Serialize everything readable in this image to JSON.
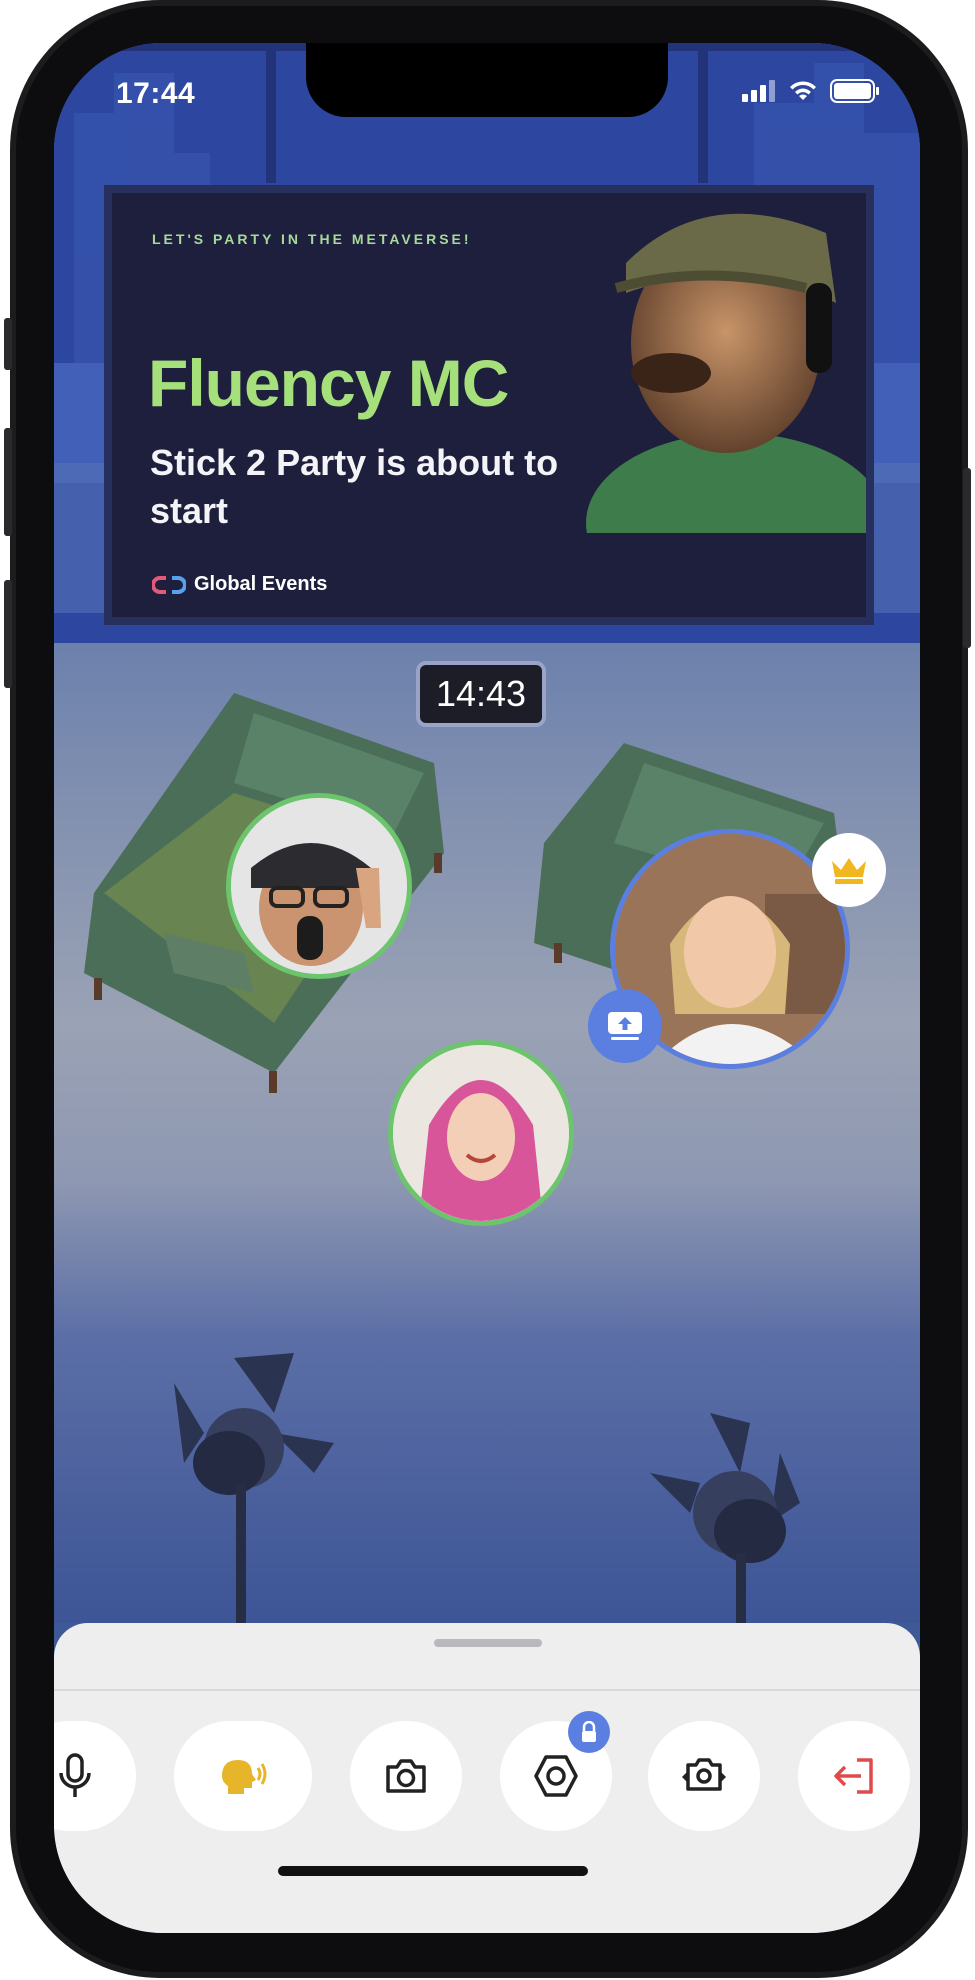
{
  "status_bar": {
    "time": "17:44"
  },
  "banner": {
    "tagline": "LET'S PARTY IN THE METAVERSE!",
    "title": "Fluency MC",
    "subtitle": "Stick 2 Party is about to start",
    "brand": "Global Events"
  },
  "stage": {
    "clock": "14:43"
  },
  "participants": [
    {
      "name": "host-man-headset",
      "ring_color": "#6cc46c"
    },
    {
      "name": "girl-blonde",
      "ring_color": "#5b7fe0",
      "is_host": true,
      "is_sharing": true
    },
    {
      "name": "woman-pink-hair",
      "ring_color": "#6cc46c"
    }
  ],
  "toolbar": {
    "items": [
      {
        "icon": "microphone-icon"
      },
      {
        "icon": "speaking-head-icon",
        "color": "#e7b52a"
      },
      {
        "icon": "camera-icon"
      },
      {
        "icon": "hexagon-settings-icon",
        "locked": true
      },
      {
        "icon": "flip-camera-icon"
      },
      {
        "icon": "leave-icon",
        "color": "#e04a4a"
      }
    ]
  },
  "colors": {
    "accent_blue": "#5b7fe0",
    "crown_gold": "#f0b81e",
    "leave_red": "#e04a4a"
  }
}
